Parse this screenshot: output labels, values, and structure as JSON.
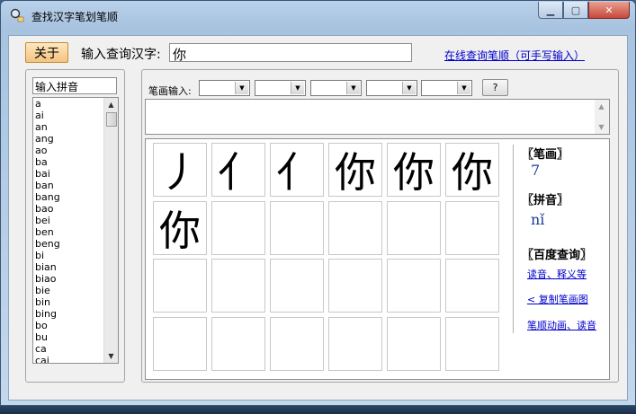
{
  "window": {
    "title": "查找汉字笔划笔顺"
  },
  "header": {
    "about_label": "关于",
    "input_label": "输入查询汉字:",
    "input_value": "你",
    "online_link": "在线查询笔顺（可手写输入）"
  },
  "pinyin": {
    "search_value": "输入拼音",
    "items": [
      "a",
      "ai",
      "an",
      "ang",
      "ao",
      "ba",
      "bai",
      "ban",
      "bang",
      "bao",
      "bei",
      "ben",
      "beng",
      "bi",
      "bian",
      "biao",
      "bie",
      "bin",
      "bing",
      "bo",
      "bu",
      "ca",
      "cai"
    ]
  },
  "strokes": {
    "label": "笔画输入:",
    "help_label": "?",
    "steps": [
      "丿",
      "亻",
      "亻",
      "你",
      "你",
      "你",
      "你"
    ]
  },
  "info": {
    "stroke_title": "〖笔画〗",
    "stroke_count": "7",
    "pinyin_title": "〖拼音〗",
    "pinyin_value": "nǐ",
    "baidu_title": "〖百度查询〗",
    "link_reading": "读音、释义等",
    "link_copy": "< 复制笔画图",
    "link_animation": "笔顺动画、读音"
  }
}
